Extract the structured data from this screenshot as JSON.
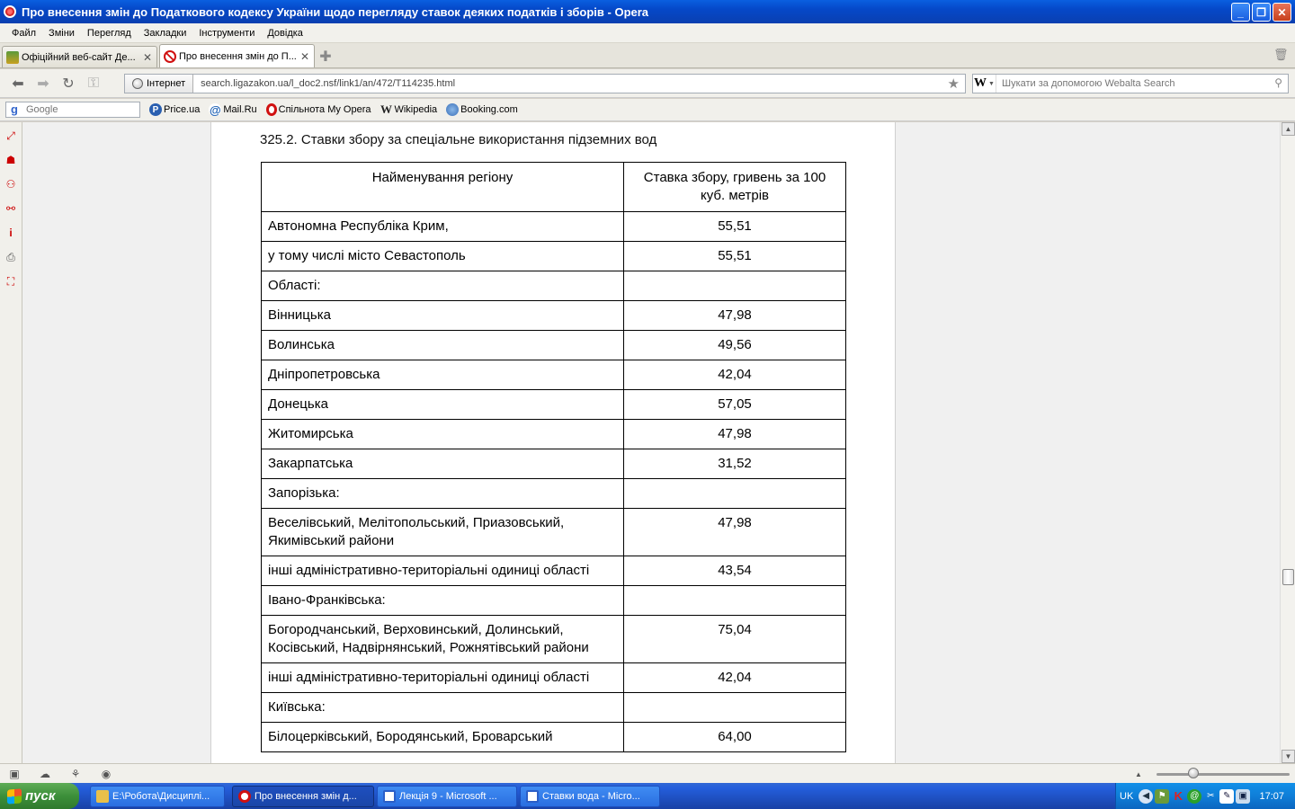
{
  "window": {
    "title": "Про внесення змін до Податкового кодексу України щодо перегляду ставок деяких податків і зборів - Opera"
  },
  "menu": [
    "Файл",
    "Зміни",
    "Перегляд",
    "Закладки",
    "Інструменти",
    "Довідка"
  ],
  "tabs": [
    {
      "label": "Офіційний веб-сайт Де...",
      "active": false
    },
    {
      "label": "Про внесення змін до П...",
      "active": true
    }
  ],
  "address": {
    "security_label": "Інтернет",
    "url": "search.ligazakon.ua/l_doc2.nsf/link1/an/472/T114235.html"
  },
  "search": {
    "engine_letter": "W",
    "placeholder": "Шукати за допомогою Webalta Search"
  },
  "bookmarks": {
    "google_placeholder": "Google",
    "items": [
      "Price.ua",
      "Mail.Ru",
      "Спільнота My Opera",
      "Wikipedia",
      "Booking.com"
    ]
  },
  "document": {
    "heading": "325.2. Ставки збору за спеціальне використання підземних вод",
    "table": {
      "headers": [
        "Найменування регіону",
        "Ставка збору, гривень за 100 куб. метрів"
      ],
      "rows": [
        [
          "Автономна Республіка Крим,",
          "55,51"
        ],
        [
          "у тому числі місто Севастополь",
          "55,51"
        ],
        [
          "Області:",
          ""
        ],
        [
          "Вінницька",
          "47,98"
        ],
        [
          "Волинська",
          "49,56"
        ],
        [
          "Дніпропетровська",
          "42,04"
        ],
        [
          "Донецька",
          "57,05"
        ],
        [
          "Житомирська",
          "47,98"
        ],
        [
          "Закарпатська",
          "31,52"
        ],
        [
          "Запорізька:",
          ""
        ],
        [
          "Веселівський, Мелітопольський, Приазовський, Якимівський райони",
          "47,98"
        ],
        [
          "інші адміністративно-територіальні одиниці області",
          "43,54"
        ],
        [
          "Івано-Франківська:",
          ""
        ],
        [
          "Богородчанський, Верховинський, Долинський, Косівський, Надвірнянський, Рожнятівський райони",
          "75,04"
        ],
        [
          "інші адміністративно-територіальні одиниці області",
          "42,04"
        ],
        [
          "Київська:",
          ""
        ],
        [
          "Білоцерківський, Бородянський, Броварський",
          "64,00"
        ]
      ]
    }
  },
  "taskbar": {
    "start_label": "пуск",
    "tasks": [
      {
        "label": "E:\\Робота\\Дисциплі...",
        "active": false,
        "color": "#e8c04a"
      },
      {
        "label": "Про внесення змін д...",
        "active": true,
        "color": "#d01010"
      },
      {
        "label": "Лекція 9 - Microsoft ...",
        "active": false,
        "color": "#2b5fc8"
      },
      {
        "label": "Ставки вода - Micro...",
        "active": false,
        "color": "#2b5fc8"
      }
    ],
    "tray_lang": "UK",
    "clock": "17:07"
  },
  "colors": {
    "titlebar": "#0548c8",
    "taskbar": "#245edb",
    "start_button": "#3c8f3a"
  }
}
